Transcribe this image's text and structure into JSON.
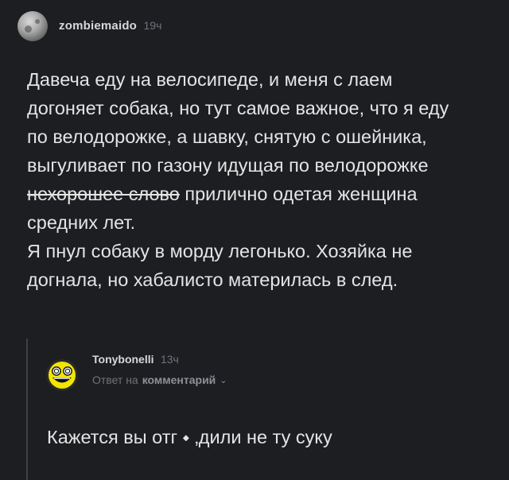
{
  "post": {
    "username": "zombiemaido",
    "time": "19ч",
    "lines": [
      "Давеча еду на велосипеде, и меня с лаем",
      "догоняет собака, но тут самое важное, что я еду",
      "по велодорожке, а шавку, снятую с ошейника,",
      "выгуливает по газону идущая по велодорожке"
    ],
    "strike_text": "нехорошее слово",
    "line5_rest": " прилично одетая женщина",
    "line6": "средних лет.",
    "line7": "Я пнул собаку в морду легонько. Хозяйка не",
    "line8": "догнала, но хабалисто материлась в след."
  },
  "reply": {
    "username": "Tonybonelli",
    "time": "13ч",
    "reply_to_prefix": "Ответ на",
    "reply_to_target": "комментарий",
    "text": "Кажется вы отг ⬩ ‚дили не ту суку"
  },
  "colors": {
    "background": "#1c1e21",
    "text": "#e4e4e4",
    "muted": "#6f7378",
    "smiley": "#f2e600"
  }
}
